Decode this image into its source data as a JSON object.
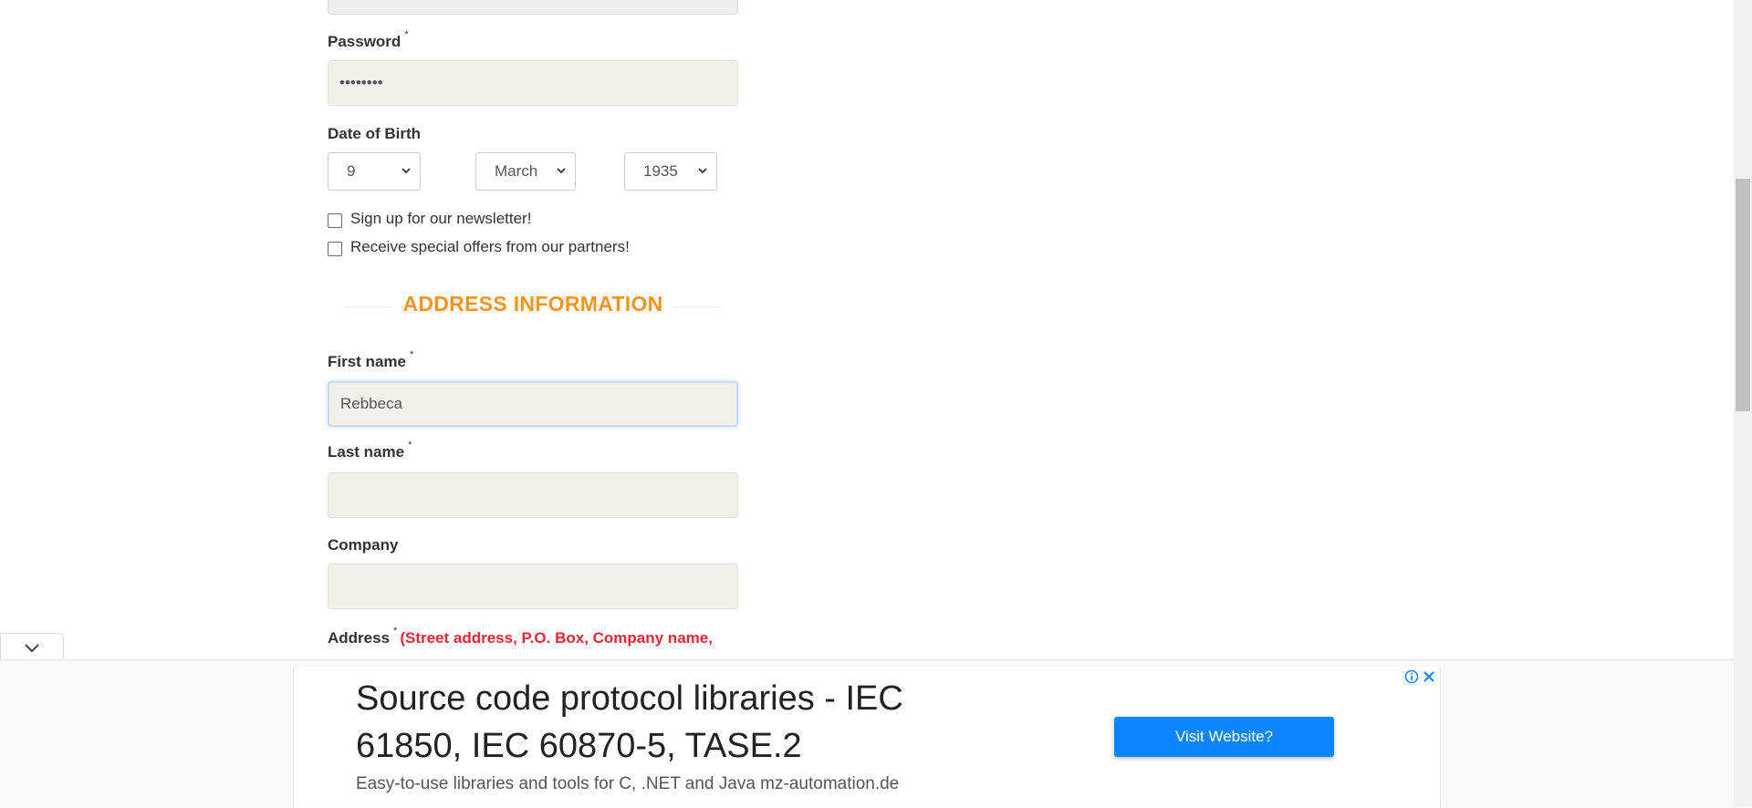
{
  "form": {
    "password": {
      "label": "Password",
      "required_mark": "*",
      "value": "••••••••"
    },
    "dob": {
      "label": "Date of Birth",
      "day": "9",
      "month": "March",
      "year": "1935"
    },
    "newsletter_label": "Sign up for our newsletter!",
    "offers_label": "Receive special offers from our partners!",
    "address_section_title": "ADDRESS INFORMATION",
    "first_name": {
      "label": "First name",
      "required_mark": "*",
      "value": "Rebbeca"
    },
    "last_name": {
      "label": "Last name",
      "required_mark": "*",
      "value": ""
    },
    "company": {
      "label": "Company",
      "value": ""
    },
    "address": {
      "label": "Address",
      "required_mark": "*",
      "hint": "(Street address, P.O. Box, Company name,"
    }
  },
  "ad": {
    "title": "Source code protocol libraries - IEC 61850, IEC 60870-5, TASE.2",
    "description": "Easy-to-use libraries and tools for C, .NET and Java mz-automation.de",
    "button_label": "Visit Website?"
  },
  "colors": {
    "section_title": "#f7941d",
    "hint_red": "#e8273b",
    "ad_button": "#0a84ff",
    "field_bg": "#f0efea"
  }
}
